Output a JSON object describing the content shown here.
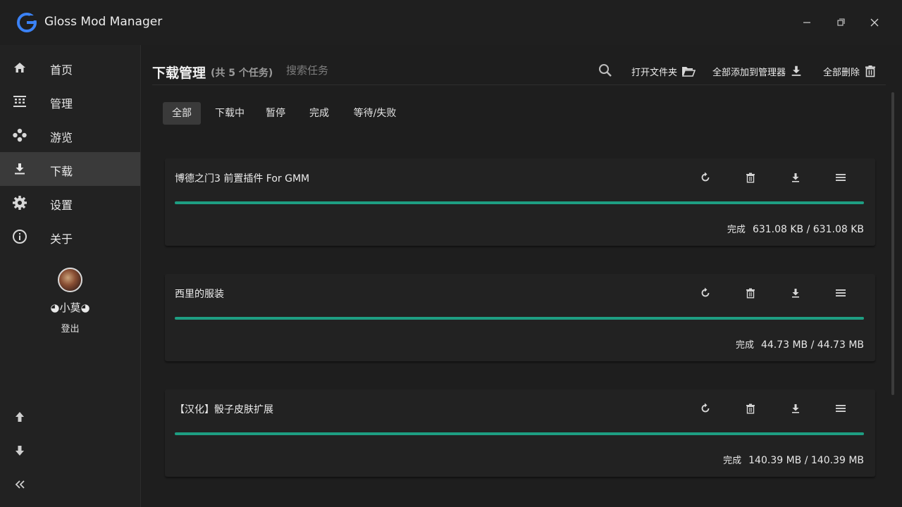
{
  "app": {
    "title": "Gloss Mod Manager",
    "logo_letter": "G",
    "logo_color": "#3b82f6"
  },
  "window_controls": {
    "minimize_icon": "minimize-icon",
    "maximize_icon": "maximize-icon",
    "close_icon": "close-icon"
  },
  "sidebar": {
    "items": [
      {
        "label": "首页",
        "icon": "home-icon"
      },
      {
        "label": "管理",
        "icon": "grid-icon"
      },
      {
        "label": "游览",
        "icon": "gamepad-icon"
      },
      {
        "label": "下载",
        "icon": "download-icon",
        "active": true
      },
      {
        "label": "设置",
        "icon": "gear-icon"
      },
      {
        "label": "关于",
        "icon": "info-icon"
      }
    ],
    "user": {
      "name": "◕小莫◕",
      "logout": "登出"
    },
    "bottom": [
      "arrow-up-icon",
      "arrow-down-icon",
      "collapse-icon"
    ]
  },
  "header": {
    "title": "下载管理",
    "count": "(共 5 个任务)",
    "search_placeholder": "搜索任务",
    "open_folder": "打开文件夹",
    "add_all": "全部添加到管理器",
    "delete_all": "全部删除"
  },
  "tabs": [
    {
      "label": "全部",
      "active": true
    },
    {
      "label": "下载中"
    },
    {
      "label": "暂停"
    },
    {
      "label": "完成"
    },
    {
      "label": "等待/失败"
    }
  ],
  "downloads": [
    {
      "name": "博德之门3 前置插件 For GMM",
      "status": "完成",
      "size": "631.08 KB / 631.08 KB",
      "progress": 1.0
    },
    {
      "name": "西里的服装",
      "status": "完成",
      "size": "44.73 MB / 44.73 MB",
      "progress": 1.0
    },
    {
      "name": "【汉化】骰子皮肤扩展",
      "status": "完成",
      "size": "140.39 MB / 140.39 MB",
      "progress": 1.0
    }
  ],
  "colors": {
    "accent": "#1e9e82",
    "active_bg": "#3a3a3a",
    "background": "#1e1e1e"
  }
}
